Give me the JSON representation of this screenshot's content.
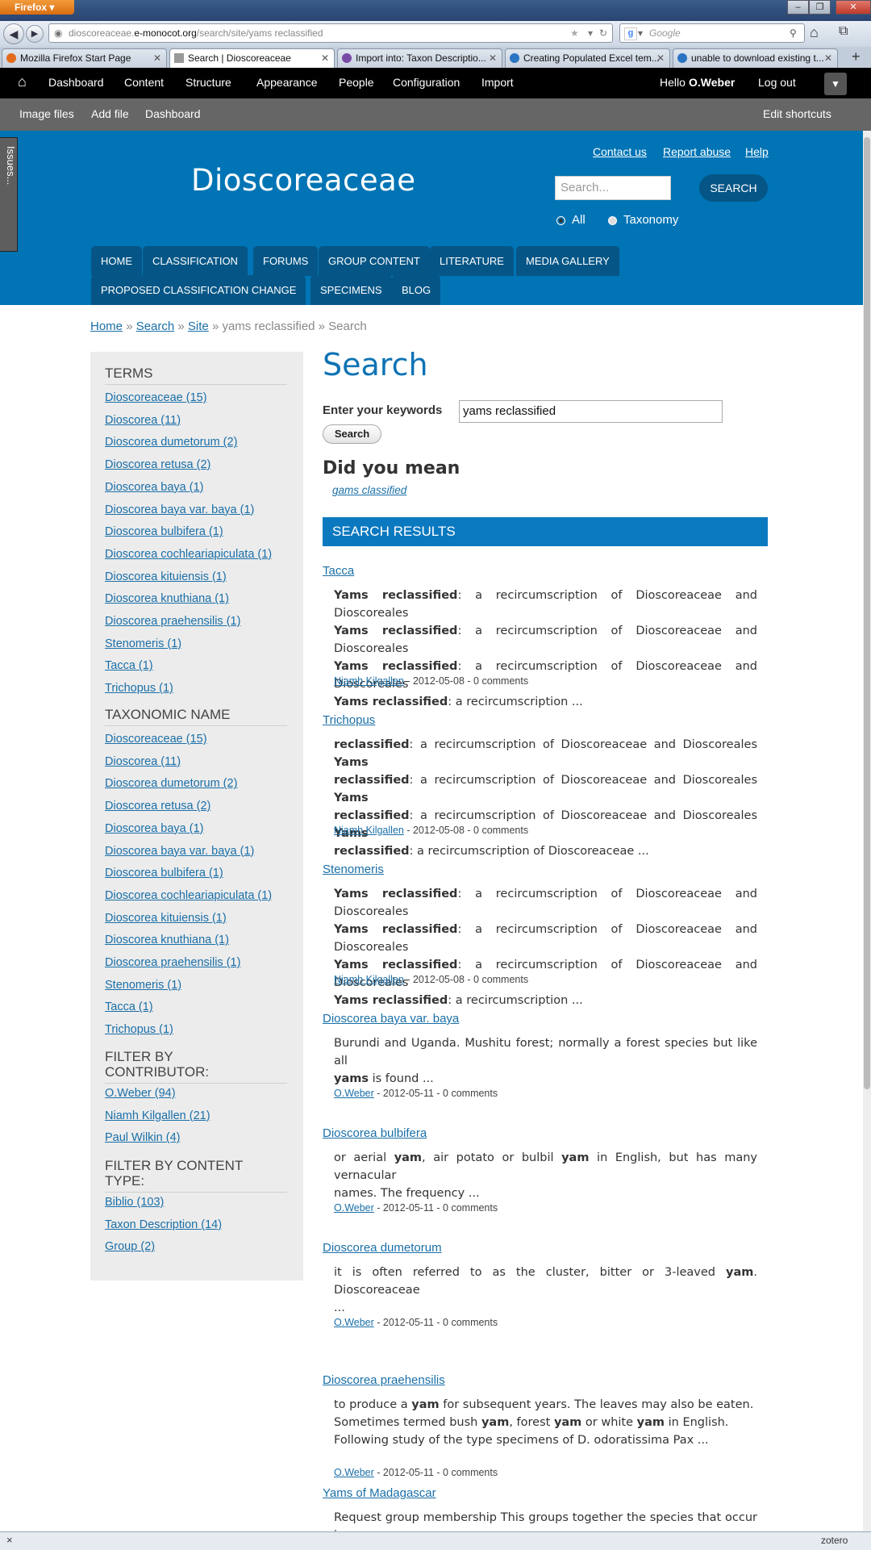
{
  "browser": {
    "menu_label": "Firefox",
    "url_host": "dioscoreaceae.",
    "url_domain": "e-monocot.org",
    "url_path": "/search/site/yams reclassified",
    "search_engine_placeholder": "Google",
    "tabs": [
      {
        "label": "Mozilla Firefox Start Page"
      },
      {
        "label": "Search | Dioscoreaceae"
      },
      {
        "label": "Import into: Taxon Descriptio..."
      },
      {
        "label": "Creating Populated Excel tem..."
      },
      {
        "label": "unable to download existing t..."
      }
    ],
    "status_left": "×",
    "status_right": "zotero"
  },
  "toolbar": {
    "items": [
      "Dashboard",
      "Content",
      "Structure",
      "Appearance",
      "People",
      "Configuration",
      "Import"
    ],
    "hello": "Hello",
    "user": "O.Weber",
    "logout": "Log out"
  },
  "shortcuts": {
    "items": [
      "Image files",
      "Add file",
      "Dashboard"
    ],
    "edit": "Edit shortcuts"
  },
  "issues_tab": "Issues...",
  "header": {
    "site_name": "Dioscoreaceae",
    "links": [
      "Contact us",
      "Report abuse",
      "Help"
    ],
    "search_placeholder": "Search...",
    "search_button": "SEARCH",
    "radio_all": "All",
    "radio_taxonomy": "Taxonomy",
    "nav_row1": [
      "HOME",
      "CLASSIFICATION",
      "FORUMS",
      "GROUP CONTENT",
      "LITERATURE",
      "MEDIA GALLERY"
    ],
    "nav_row2": [
      "PROPOSED CLASSIFICATION CHANGE",
      "SPECIMENS",
      "BLOG"
    ]
  },
  "breadcrumb": {
    "home": "Home",
    "search": "Search",
    "site": "Site",
    "sep": "»",
    "rest": "yams reclassified » Search"
  },
  "sidebar": {
    "terms_title": "TERMS",
    "terms": [
      "Dioscoreaceae (15)",
      "Dioscorea (11)",
      "Dioscorea dumetorum (2)",
      "Dioscorea retusa (2)",
      "Dioscorea baya (1)",
      "Dioscorea baya var. baya (1)",
      "Dioscorea bulbifera (1)",
      "Dioscorea cochleariapiculata (1)",
      "Dioscorea kituiensis (1)",
      "Dioscorea knuthiana (1)",
      "Dioscorea praehensilis (1)",
      "Stenomeris (1)",
      "Tacca (1)",
      "Trichopus (1)"
    ],
    "taxon_title": "TAXONOMIC NAME",
    "taxon": [
      "Dioscoreaceae (15)",
      "Dioscorea (11)",
      "Dioscorea dumetorum (2)",
      "Dioscorea retusa (2)",
      "Dioscorea baya (1)",
      "Dioscorea baya var. baya (1)",
      "Dioscorea bulbifera (1)",
      "Dioscorea cochleariapiculata (1)",
      "Dioscorea kituiensis (1)",
      "Dioscorea knuthiana (1)",
      "Dioscorea praehensilis (1)",
      "Stenomeris (1)",
      "Tacca (1)",
      "Trichopus (1)"
    ],
    "contrib_title_1": "FILTER BY",
    "contrib_title_2": "CONTRIBUTOR:",
    "contrib": [
      "O.Weber (94)",
      "Niamh Kilgallen (21)",
      "Paul Wilkin (4)"
    ],
    "ctype_title_1": "FILTER BY CONTENT",
    "ctype_title_2": "TYPE:",
    "ctype": [
      "Biblio (103)",
      "Taxon Description (14)",
      "Group (2)"
    ]
  },
  "main": {
    "title": "Search",
    "keywords_label": "Enter your keywords",
    "keywords_value": "yams reclassified",
    "search_button": "Search",
    "did_you_mean": "Did you mean",
    "suggestion": "gams classified",
    "results_header": "SEARCH RESULTS",
    "meta_sep": " - ",
    "results": [
      {
        "title": "Tacca",
        "lines": [
          [
            "Yams reclassified",
            ": a recircumscription of Dioscoreaceae and Dioscoreales"
          ],
          [
            "Yams reclassified",
            ": a recircumscription of Dioscoreaceae and Dioscoreales"
          ],
          [
            "Yams reclassified",
            ": a recircumscription of Dioscoreaceae and Dioscoreales"
          ],
          [
            "Yams reclassified",
            ": a recircumscription ..."
          ]
        ],
        "author": "Niamh Kilgallen",
        "meta": "2012-05-08 - 0 comments"
      },
      {
        "title": "Trichopus",
        "lines": [
          [
            "reclassified",
            ": a recircumscription of Dioscoreaceae and Dioscoreales ",
            "Yams"
          ],
          [
            "reclassified",
            ": a recircumscription of Dioscoreaceae and Dioscoreales ",
            "Yams"
          ],
          [
            "reclassified",
            ": a recircumscription of Dioscoreaceae and Dioscoreales ",
            "Yams"
          ],
          [
            "reclassified",
            ": a recircumscription of Dioscoreaceae ..."
          ]
        ],
        "author": "Niamh Kilgallen",
        "meta": "2012-05-08 - 0 comments"
      },
      {
        "title": "Stenomeris",
        "lines": [
          [
            "Yams reclassified",
            ": a recircumscription of Dioscoreaceae and Dioscoreales"
          ],
          [
            "Yams reclassified",
            ": a recircumscription of Dioscoreaceae and Dioscoreales"
          ],
          [
            "Yams reclassified",
            ": a recircumscription of Dioscoreaceae and Dioscoreales"
          ],
          [
            "Yams reclassified",
            ": a recircumscription ..."
          ]
        ],
        "author": "Niamh Kilgallen",
        "meta": "2012-05-08 - 0 comments"
      },
      {
        "title": "Dioscorea baya var. baya",
        "lines": [
          [
            "",
            "Burundi and Uganda. Mushitu forest; normally a forest species but like all"
          ],
          [
            "yams",
            " is found ..."
          ]
        ],
        "author": "O.Weber",
        "meta": "2012-05-11 - 0 comments"
      },
      {
        "title": "Dioscorea bulbifera",
        "lines": [
          [
            "",
            "or aerial ",
            "yam",
            ", air potato or bulbil ",
            "yam",
            " in English, but has many vernacular"
          ],
          [
            "",
            "names. The frequency ..."
          ]
        ],
        "author": "O.Weber",
        "meta": "2012-05-11 - 0 comments"
      },
      {
        "title": "Dioscorea dumetorum",
        "lines": [
          [
            "",
            "it is often referred to as the cluster, bitter or 3-leaved ",
            "yam",
            ". Dioscoreaceae"
          ],
          [
            "",
            "..."
          ]
        ],
        "author": "O.Weber",
        "meta": "2012-05-11 - 0 comments"
      },
      {
        "title": "Dioscorea praehensilis",
        "lines": [
          [
            "",
            "to produce a ",
            "yam",
            " for subsequent years. The leaves may also be eaten."
          ],
          [
            "",
            "Sometimes termed bush ",
            "yam",
            ", forest ",
            "yam",
            " or white ",
            "yam",
            " in English."
          ],
          [
            "",
            "Following study of the type specimens of D. odoratissima Pax ..."
          ]
        ],
        "author": "O.Weber",
        "meta": "2012-05-11 - 0 comments"
      },
      {
        "title": "Yams of Madagascar",
        "lines": [
          [
            "",
            "Request group membership This groups together the species that occur in"
          ]
        ],
        "author": "",
        "meta": ""
      }
    ]
  }
}
